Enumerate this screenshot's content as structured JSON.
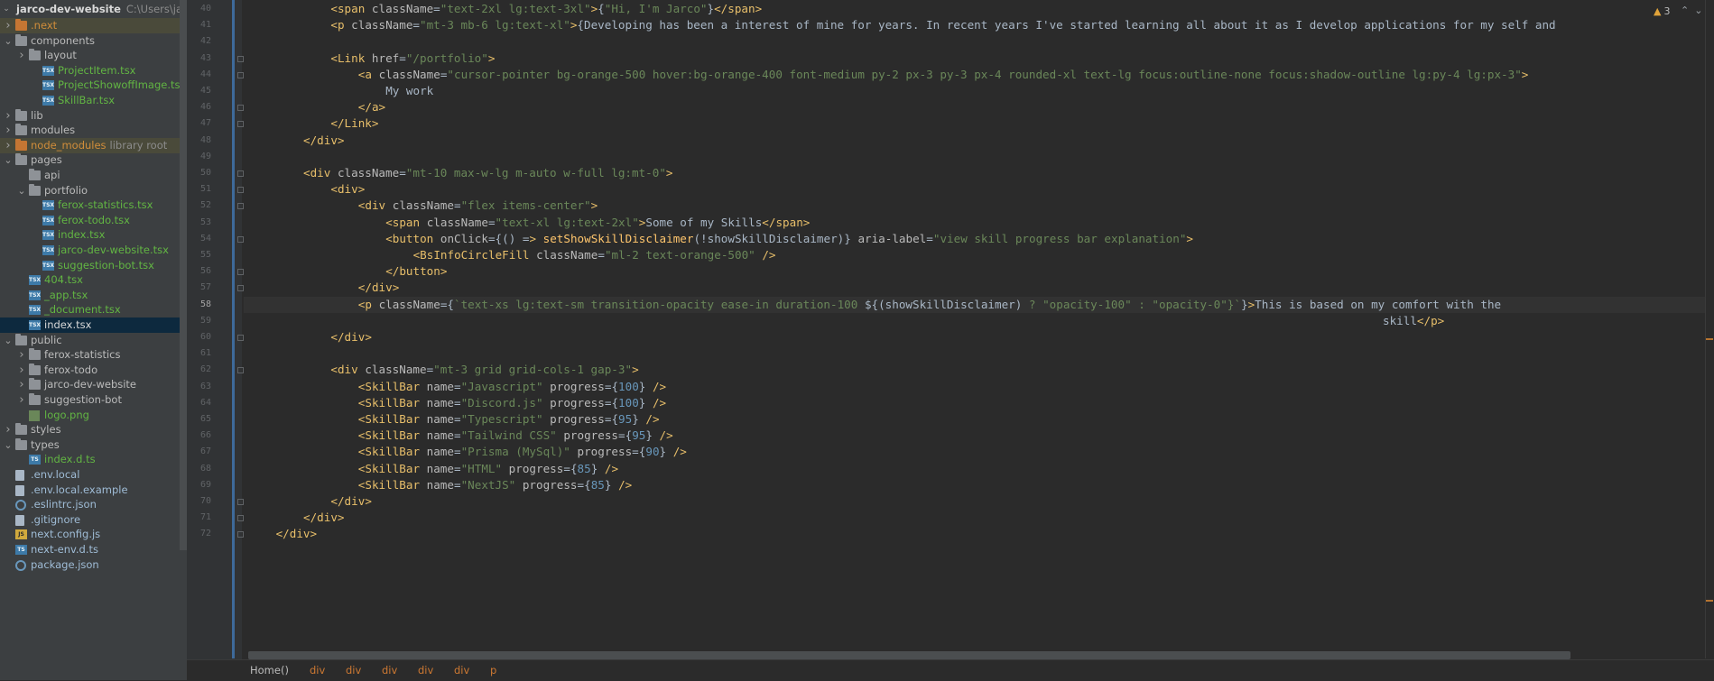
{
  "project_tree": {
    "root": {
      "label": "jarco-dev-website",
      "path": "C:\\Users\\jarco\\"
    },
    "items": [
      {
        "label": ".next",
        "type": "folder",
        "color": "orange"
      },
      {
        "label": "components",
        "type": "folder"
      },
      {
        "label": "layout",
        "type": "folder"
      },
      {
        "label": "ProjectItem.tsx",
        "type": "tsx"
      },
      {
        "label": "ProjectShowoffImage.tsx",
        "type": "tsx"
      },
      {
        "label": "SkillBar.tsx",
        "type": "tsx"
      },
      {
        "label": "lib",
        "type": "folder"
      },
      {
        "label": "modules",
        "type": "folder"
      },
      {
        "label": "node_modules",
        "type": "folder",
        "color": "orange",
        "suffix": "library root"
      },
      {
        "label": "pages",
        "type": "folder"
      },
      {
        "label": "api",
        "type": "folder"
      },
      {
        "label": "portfolio",
        "type": "folder"
      },
      {
        "label": "ferox-statistics.tsx",
        "type": "tsx"
      },
      {
        "label": "ferox-todo.tsx",
        "type": "tsx"
      },
      {
        "label": "index.tsx",
        "type": "tsx"
      },
      {
        "label": "jarco-dev-website.tsx",
        "type": "tsx"
      },
      {
        "label": "suggestion-bot.tsx",
        "type": "tsx"
      },
      {
        "label": "404.tsx",
        "type": "tsx"
      },
      {
        "label": "_app.tsx",
        "type": "tsx"
      },
      {
        "label": "_document.tsx",
        "type": "tsx"
      },
      {
        "label": "index.tsx",
        "type": "tsx",
        "selected": true
      },
      {
        "label": "public",
        "type": "folder"
      },
      {
        "label": "ferox-statistics",
        "type": "folder"
      },
      {
        "label": "ferox-todo",
        "type": "folder"
      },
      {
        "label": "jarco-dev-website",
        "type": "folder"
      },
      {
        "label": "suggestion-bot",
        "type": "folder"
      },
      {
        "label": "logo.png",
        "type": "image"
      },
      {
        "label": "styles",
        "type": "folder"
      },
      {
        "label": "types",
        "type": "folder"
      },
      {
        "label": "index.d.ts",
        "type": "ts"
      },
      {
        "label": ".env.local",
        "type": "text"
      },
      {
        "label": ".env.local.example",
        "type": "text"
      },
      {
        "label": ".eslintrc.json",
        "type": "json"
      },
      {
        "label": ".gitignore",
        "type": "text"
      },
      {
        "label": "next.config.js",
        "type": "js"
      },
      {
        "label": "next-env.d.ts",
        "type": "ts"
      },
      {
        "label": "package.json",
        "type": "json"
      }
    ]
  },
  "editor": {
    "current_line": "58",
    "lines": [
      {
        "num": "40",
        "code": "<span className=\"text-2xl lg:text-3xl\">{\"Hi, I'm Jarco\"}</span>"
      },
      {
        "num": "41",
        "code": "<p className=\"mt-3 mb-6 lg:text-xl\">{\"Developing has been a interest of mine for years. In recent years I've started learning all about it as I develop applications for my self and"
      },
      {
        "num": "42",
        "code": ""
      },
      {
        "num": "43",
        "code": "<Link href=\"/portfolio\">"
      },
      {
        "num": "44",
        "code": "<a className=\"cursor-pointer bg-orange-500 hover:bg-orange-400 font-medium py-2 px-3 py-3 px-4 rounded-xl text-lg focus:outline-none focus:shadow-outline lg:py-4 lg:px-3\">"
      },
      {
        "num": "45",
        "code": "My work"
      },
      {
        "num": "46",
        "code": "</a>"
      },
      {
        "num": "47",
        "code": "</Link>"
      },
      {
        "num": "48",
        "code": "</div>"
      },
      {
        "num": "49",
        "code": ""
      },
      {
        "num": "50",
        "code": "<div className=\"mt-10 max-w-lg m-auto w-full lg:mt-0\">"
      },
      {
        "num": "51",
        "code": "<div>"
      },
      {
        "num": "52",
        "code": "<div className=\"flex items-center\">"
      },
      {
        "num": "53",
        "code": "<span className=\"text-xl lg:text-2xl\">Some of my Skills</span>"
      },
      {
        "num": "54",
        "code": "<button onClick={() => setShowSkillDisclaimer(!showSkillDisclaimer)} aria-label=\"view skill progress bar explanation\">"
      },
      {
        "num": "55",
        "code": "<BsInfoCircleFill className=\"ml-2 text-orange-500\" />"
      },
      {
        "num": "56",
        "code": "</button>"
      },
      {
        "num": "57",
        "code": "</div>"
      },
      {
        "num": "58",
        "code": "<p className={`text-xs lg:text-sm transition-opacity ease-in duration-100 ${(showSkillDisclaimer) ? \"opacity-100\" : \"opacity-0\"}`}>This is based on my comfort with the"
      },
      {
        "num": "59",
        "code": "skill</p>"
      },
      {
        "num": "60",
        "code": "</div>"
      },
      {
        "num": "61",
        "code": ""
      },
      {
        "num": "62",
        "code": "<div className=\"mt-3 grid grid-cols-1 gap-3\">"
      },
      {
        "num": "63",
        "code": "<SkillBar name=\"Javascript\" progress={100} />"
      },
      {
        "num": "64",
        "code": "<SkillBar name=\"Discord.js\" progress={100} />"
      },
      {
        "num": "65",
        "code": "<SkillBar name=\"Typescript\" progress={95} />"
      },
      {
        "num": "66",
        "code": "<SkillBar name=\"Tailwind CSS\" progress={95} />"
      },
      {
        "num": "67",
        "code": "<SkillBar name=\"Prisma (MySql)\" progress={90} />"
      },
      {
        "num": "68",
        "code": "<SkillBar name=\"HTML\" progress={85} />"
      },
      {
        "num": "69",
        "code": "<SkillBar name=\"NextJS\" progress={85} />"
      },
      {
        "num": "70",
        "code": "</div>"
      },
      {
        "num": "71",
        "code": "</div>"
      },
      {
        "num": "72",
        "code": "</div>"
      }
    ]
  },
  "inspections": {
    "warning_count": "3",
    "arrows": "⌃⌄"
  },
  "breadcrumb": [
    "Home()",
    "div",
    "div",
    "div",
    "div",
    "div",
    "p"
  ],
  "colors": {
    "tag": "#e8bf6a",
    "attribute": "#bababa",
    "string": "#6a8759",
    "number": "#6897bb",
    "function": "#ffc66d",
    "keyword": "#cc7832",
    "selection": "#0d293e"
  }
}
